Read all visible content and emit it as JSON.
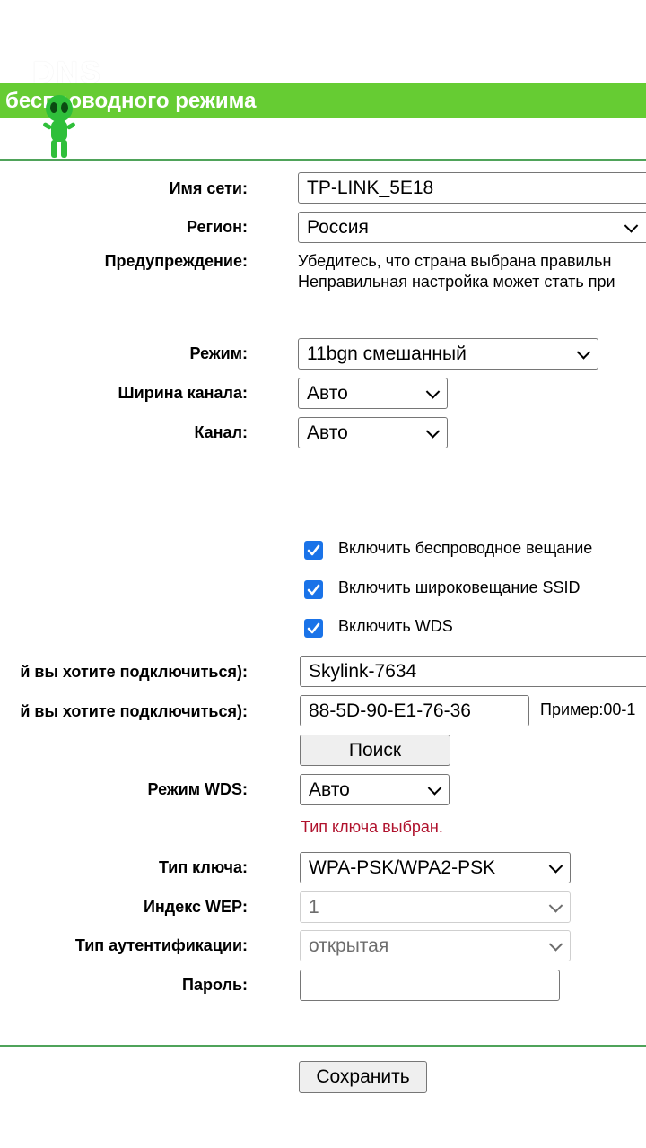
{
  "header": {
    "title": "беспроводного режима",
    "logo_text": "DNS"
  },
  "fields": {
    "ssid_label": "Имя сети:",
    "ssid_value": "TP-LINK_5E18",
    "region_label": "Регион:",
    "region_value": "Россия",
    "warning_label": "Предупреждение:",
    "warning_line1": "Убедитесь, что страна выбрана правильн",
    "warning_line2": "Неправильная настройка может стать при",
    "mode_label": "Режим:",
    "mode_value": "11bgn смешанный",
    "channel_width_label": "Ширина канала:",
    "channel_width_value": "Авто",
    "channel_label": "Канал:",
    "channel_value": "Авто"
  },
  "checkboxes": [
    {
      "label": "Включить беспроводное вещание",
      "checked": true
    },
    {
      "label": "Включить широковещание SSID",
      "checked": true
    },
    {
      "label": "Включить WDS",
      "checked": true
    }
  ],
  "wds": {
    "ssid_label": "й вы хотите подключиться):",
    "ssid_value": "Skylink-7634",
    "bssid_label": "й вы хотите подключиться):",
    "bssid_value": "88-5D-90-E1-76-36",
    "bssid_example": "Пример:00-1",
    "search_button": "Поиск",
    "mode_label": "Режим WDS:",
    "mode_value": "Авто",
    "key_status": "Тип ключа выбран.",
    "key_type_label": "Тип ключа:",
    "key_type_value": "WPA-PSK/WPA2-PSK",
    "wep_index_label": "Индекс WEP:",
    "wep_index_value": "1",
    "auth_type_label": "Тип аутентификации:",
    "auth_type_value": "открытая",
    "password_label": "Пароль:",
    "password_value": ""
  },
  "save_button": "Сохранить",
  "colors": {
    "title_bar": "#66cc33",
    "divider": "#4fa35a",
    "checkbox": "#1a73e8",
    "status_text": "#b0122d"
  }
}
